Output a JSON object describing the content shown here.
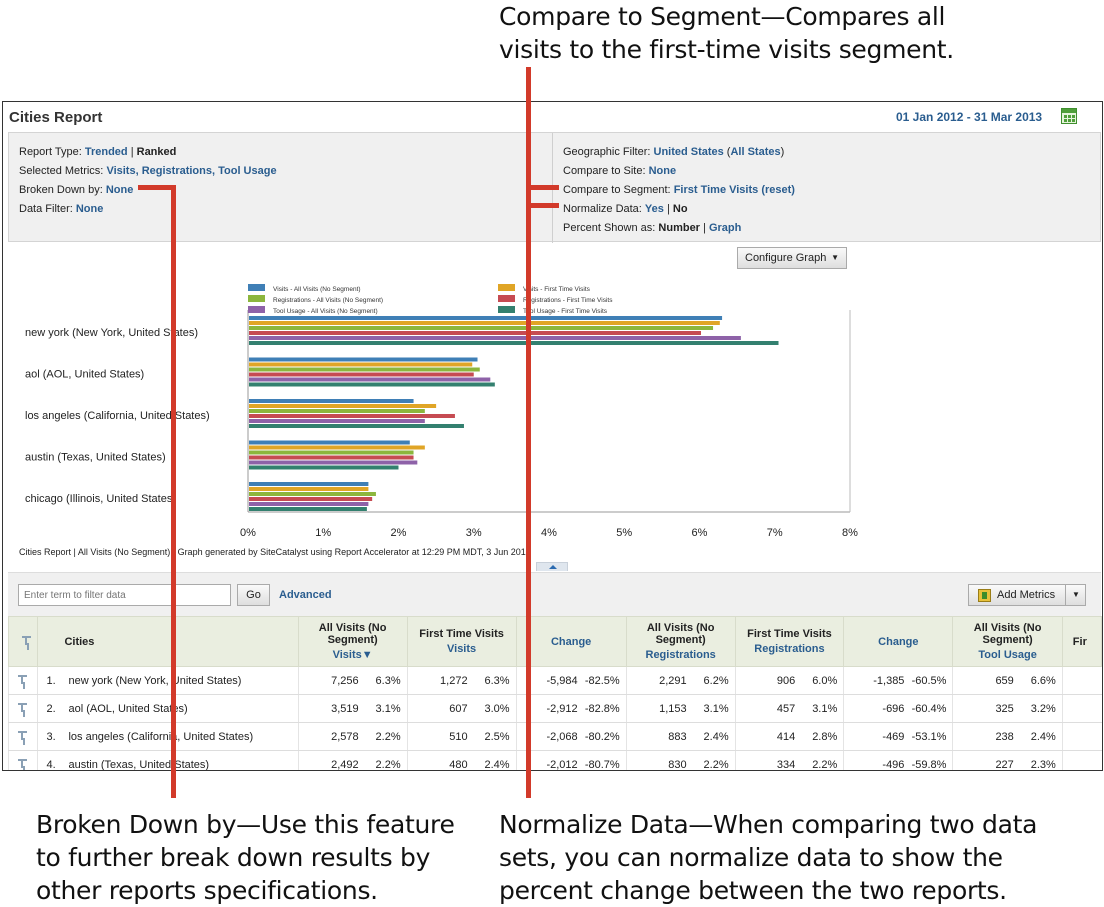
{
  "callouts": {
    "compare_segment_1": "Compare to Segment—Compares all",
    "compare_segment_2": "visits to the first-time visits segment.",
    "broken_down_1": "Broken Down by—Use this feature",
    "broken_down_2": "to further break down results by",
    "broken_down_3": "other reports specifications.",
    "normalize_1": "Normalize Data—When comparing two data",
    "normalize_2": "sets, you can normalize data to show the",
    "normalize_3": "percent change between the two reports."
  },
  "header": {
    "title": "Cities Report",
    "date_range": "01 Jan 2012 - 31 Mar 2013",
    "calendar_icon": "calendar-icon"
  },
  "settings": {
    "report_type_label": "Report Type:",
    "report_type_trended": "Trended",
    "report_type_sep": "|",
    "report_type_ranked": "Ranked",
    "selected_metrics_label": "Selected Metrics:",
    "selected_metrics_value": "Visits, Registrations, Tool Usage",
    "broken_down_label": "Broken Down by:",
    "broken_down_value": "None",
    "data_filter_label": "Data Filter:",
    "data_filter_value": "None",
    "geo_filter_label": "Geographic Filter:",
    "geo_filter_value": "United States",
    "geo_filter_open": "(",
    "geo_filter_all": "All States",
    "geo_filter_close": ")",
    "compare_site_label": "Compare to Site:",
    "compare_site_value": "None",
    "compare_segment_label": "Compare to Segment:",
    "compare_segment_value": "First Time Visits (reset)",
    "normalize_label": "Normalize Data:",
    "normalize_yes": "Yes",
    "normalize_sep": "|",
    "normalize_no": "No",
    "percent_label": "Percent Shown as:",
    "percent_number": "Number",
    "percent_sep": "|",
    "percent_graph": "Graph"
  },
  "configure_graph": {
    "label": "Configure Graph",
    "arrow": "▼"
  },
  "chart_data": {
    "type": "bar",
    "orientation": "horizontal",
    "categories": [
      "new york (New York, United States)",
      "aol (AOL, United States)",
      "los angeles (California, United States)",
      "austin (Texas, United States)",
      "chicago (Illinois, United States)"
    ],
    "series": [
      {
        "name": "Visits - All Visits (No Segment)",
        "color": "#3f7fb6",
        "values": [
          6.3,
          3.05,
          2.2,
          2.15,
          1.6
        ]
      },
      {
        "name": "Visits - First Time Visits",
        "color": "#e0a526",
        "values": [
          6.27,
          2.98,
          2.5,
          2.35,
          1.6
        ]
      },
      {
        "name": "Registrations - All Visits (No Segment)",
        "color": "#8cb63d",
        "values": [
          6.18,
          3.08,
          2.35,
          2.2,
          1.7
        ]
      },
      {
        "name": "Registrations - First Time Visits",
        "color": "#c64b52",
        "values": [
          6.02,
          3.0,
          2.75,
          2.2,
          1.65
        ]
      },
      {
        "name": "Tool Usage - All Visits (No Segment)",
        "color": "#8e62a8",
        "values": [
          6.55,
          3.22,
          2.35,
          2.25,
          1.6
        ]
      },
      {
        "name": "Tool Usage - First Time Visits",
        "color": "#33806f",
        "values": [
          7.05,
          3.28,
          2.87,
          2.0,
          1.58
        ]
      }
    ],
    "x_ticks": [
      "0%",
      "1%",
      "2%",
      "3%",
      "4%",
      "5%",
      "6%",
      "7%",
      "8%"
    ],
    "xlim": [
      0,
      8
    ],
    "grid": false,
    "legend_position": "top"
  },
  "chart_footnote": "Cities Report | All Visits (No Segment) | Graph generated by SiteCatalyst using Report Accelerator at 12:29 PM MDT,  3 Jun 2013",
  "filter": {
    "placeholder": "Enter term to filter data",
    "go_label": "Go",
    "advanced_label": "Advanced",
    "add_metrics_label": "Add Metrics",
    "add_metrics_arrow": "▼"
  },
  "table": {
    "col_cities": "Cities",
    "col1_main": "All Visits (No Segment)",
    "col1_sub": "Visits▼",
    "col2_main": "First Time Visits",
    "col2_sub": "Visits",
    "col3": "Change",
    "col4_main": "All Visits (No Segment)",
    "col4_sub": "Registrations",
    "col5_main": "First Time Visits",
    "col5_sub": "Registrations",
    "col6": "Change",
    "col7_main": "All Visits (No Segment)",
    "col7_sub": "Tool Usage",
    "col8_main": "Fir",
    "rows": [
      {
        "rank": "1.",
        "city": "new york (New York, United States)",
        "v_all": "7,256",
        "v_all_pct": "6.3%",
        "v_ft": "1,272",
        "v_ft_pct": "6.3%",
        "v_chg": "-5,984",
        "v_chg_pct": "-82.5%",
        "r_all": "2,291",
        "r_all_pct": "6.2%",
        "r_ft": "906",
        "r_ft_pct": "6.0%",
        "r_chg": "-1,385",
        "r_chg_pct": "-60.5%",
        "t_all": "659",
        "t_all_pct": "6.6%"
      },
      {
        "rank": "2.",
        "city": "aol (AOL, United States)",
        "v_all": "3,519",
        "v_all_pct": "3.1%",
        "v_ft": "607",
        "v_ft_pct": "3.0%",
        "v_chg": "-2,912",
        "v_chg_pct": "-82.8%",
        "r_all": "1,153",
        "r_all_pct": "3.1%",
        "r_ft": "457",
        "r_ft_pct": "3.1%",
        "r_chg": "-696",
        "r_chg_pct": "-60.4%",
        "t_all": "325",
        "t_all_pct": "3.2%"
      },
      {
        "rank": "3.",
        "city": "los angeles (California, United States)",
        "v_all": "2,578",
        "v_all_pct": "2.2%",
        "v_ft": "510",
        "v_ft_pct": "2.5%",
        "v_chg": "-2,068",
        "v_chg_pct": "-80.2%",
        "r_all": "883",
        "r_all_pct": "2.4%",
        "r_ft": "414",
        "r_ft_pct": "2.8%",
        "r_chg": "-469",
        "r_chg_pct": "-53.1%",
        "t_all": "238",
        "t_all_pct": "2.4%"
      },
      {
        "rank": "4.",
        "city": "austin (Texas, United States)",
        "v_all": "2,492",
        "v_all_pct": "2.2%",
        "v_ft": "480",
        "v_ft_pct": "2.4%",
        "v_chg": "-2,012",
        "v_chg_pct": "-80.7%",
        "r_all": "830",
        "r_all_pct": "2.2%",
        "r_ft": "334",
        "r_ft_pct": "2.2%",
        "r_chg": "-496",
        "r_chg_pct": "-59.8%",
        "t_all": "227",
        "t_all_pct": "2.3%"
      }
    ]
  }
}
